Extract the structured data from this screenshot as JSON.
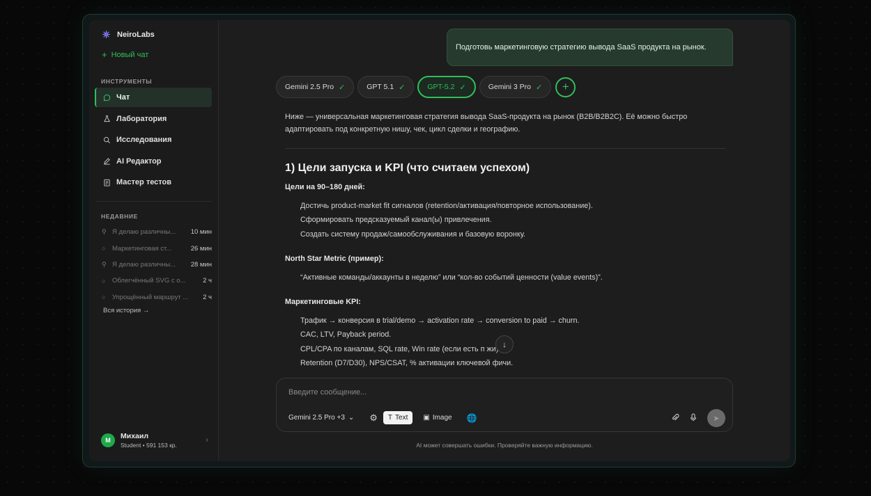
{
  "brand": {
    "name": "NeiroLabs"
  },
  "sidebar": {
    "new_chat": "Новый чат",
    "tools_title": "ИНСТРУМЕНТЫ",
    "items": [
      {
        "label": "Чат",
        "icon": "chat-icon"
      },
      {
        "label": "Лаборатория",
        "icon": "flask-icon"
      },
      {
        "label": "Исследования",
        "icon": "search-icon"
      },
      {
        "label": "AI Редактор",
        "icon": "pen-icon"
      },
      {
        "label": "Мастер тестов",
        "icon": "clipboard-icon"
      }
    ],
    "recent_title": "НЕДАВНИЕ",
    "recent": [
      {
        "label": "Я делаю различны...",
        "time": "10 мин",
        "icon": "search-icon"
      },
      {
        "label": "Маркетинговая ст...",
        "time": "26 мин",
        "icon": "chat-icon"
      },
      {
        "label": "Я делаю различны...",
        "time": "28 мин",
        "icon": "search-icon"
      },
      {
        "label": "Облегчённый SVG с о...",
        "time": "2 ч",
        "icon": "chat-icon"
      },
      {
        "label": "Упрощённый маршрут ...",
        "time": "2 ч",
        "icon": "chat-icon"
      }
    ],
    "history": "Вся история →",
    "user": {
      "initial": "M",
      "name": "Михаил",
      "sub": "Student • 591 153 кр."
    }
  },
  "chat": {
    "user_message": "Подготовь маркетинговую стратегию вывода SaaS продукта на рынок.",
    "models": [
      {
        "label": "Gemini 2.5 Pro",
        "active": false
      },
      {
        "label": "GPT 5.1",
        "active": false
      },
      {
        "label": "GPT-5.2",
        "active": true
      },
      {
        "label": "Gemini 3 Pro",
        "active": false
      }
    ],
    "intro": "Ниже — универсальная маркетинговая стратегия вывода SaaS-продукта на рынок (B2B/B2B2C). Её можно быстро адаптировать под конкретную нишу, чек, цикл сделки и географию.",
    "heading": "1) Цели запуска и KPI (что считаем успехом)",
    "goals_title": "Цели на 90–180 дней:",
    "goals": [
      "Достичь product-market fit сигналов (retention/активация/повторное использование).",
      "Сформировать предсказуемый канал(ы) привлечения.",
      "Создать систему продаж/самообслуживания и базовую воронку."
    ],
    "nsm_title": "North Star Metric (пример):",
    "nsm": [
      "“Активные команды/аккаунты в неделю” или “кол-во событий ценности (value events)”."
    ],
    "kpi_title": "Маркетинговые KPI:",
    "kpi": [
      "Трафик → конверсия в trial/demo → activation rate → conversion to paid → churn.",
      "CAC, LTV, Payback period.",
      "CPL/CPA по каналам, SQL rate, Win rate (если есть п жи).",
      "Retention (D7/D30), NPS/CSAT, % активации ключевой фичи."
    ]
  },
  "composer": {
    "placeholder": "Введите сообщение...",
    "model": "Gemini 2.5 Pro +3",
    "text_mode": "Text",
    "image_mode": "Image"
  },
  "disclaimer": "AI может совершать ошибки. Проверяйте важную информацию.",
  "colors": {
    "accent": "#2fbf5a",
    "bg": "#1d1d1d"
  }
}
